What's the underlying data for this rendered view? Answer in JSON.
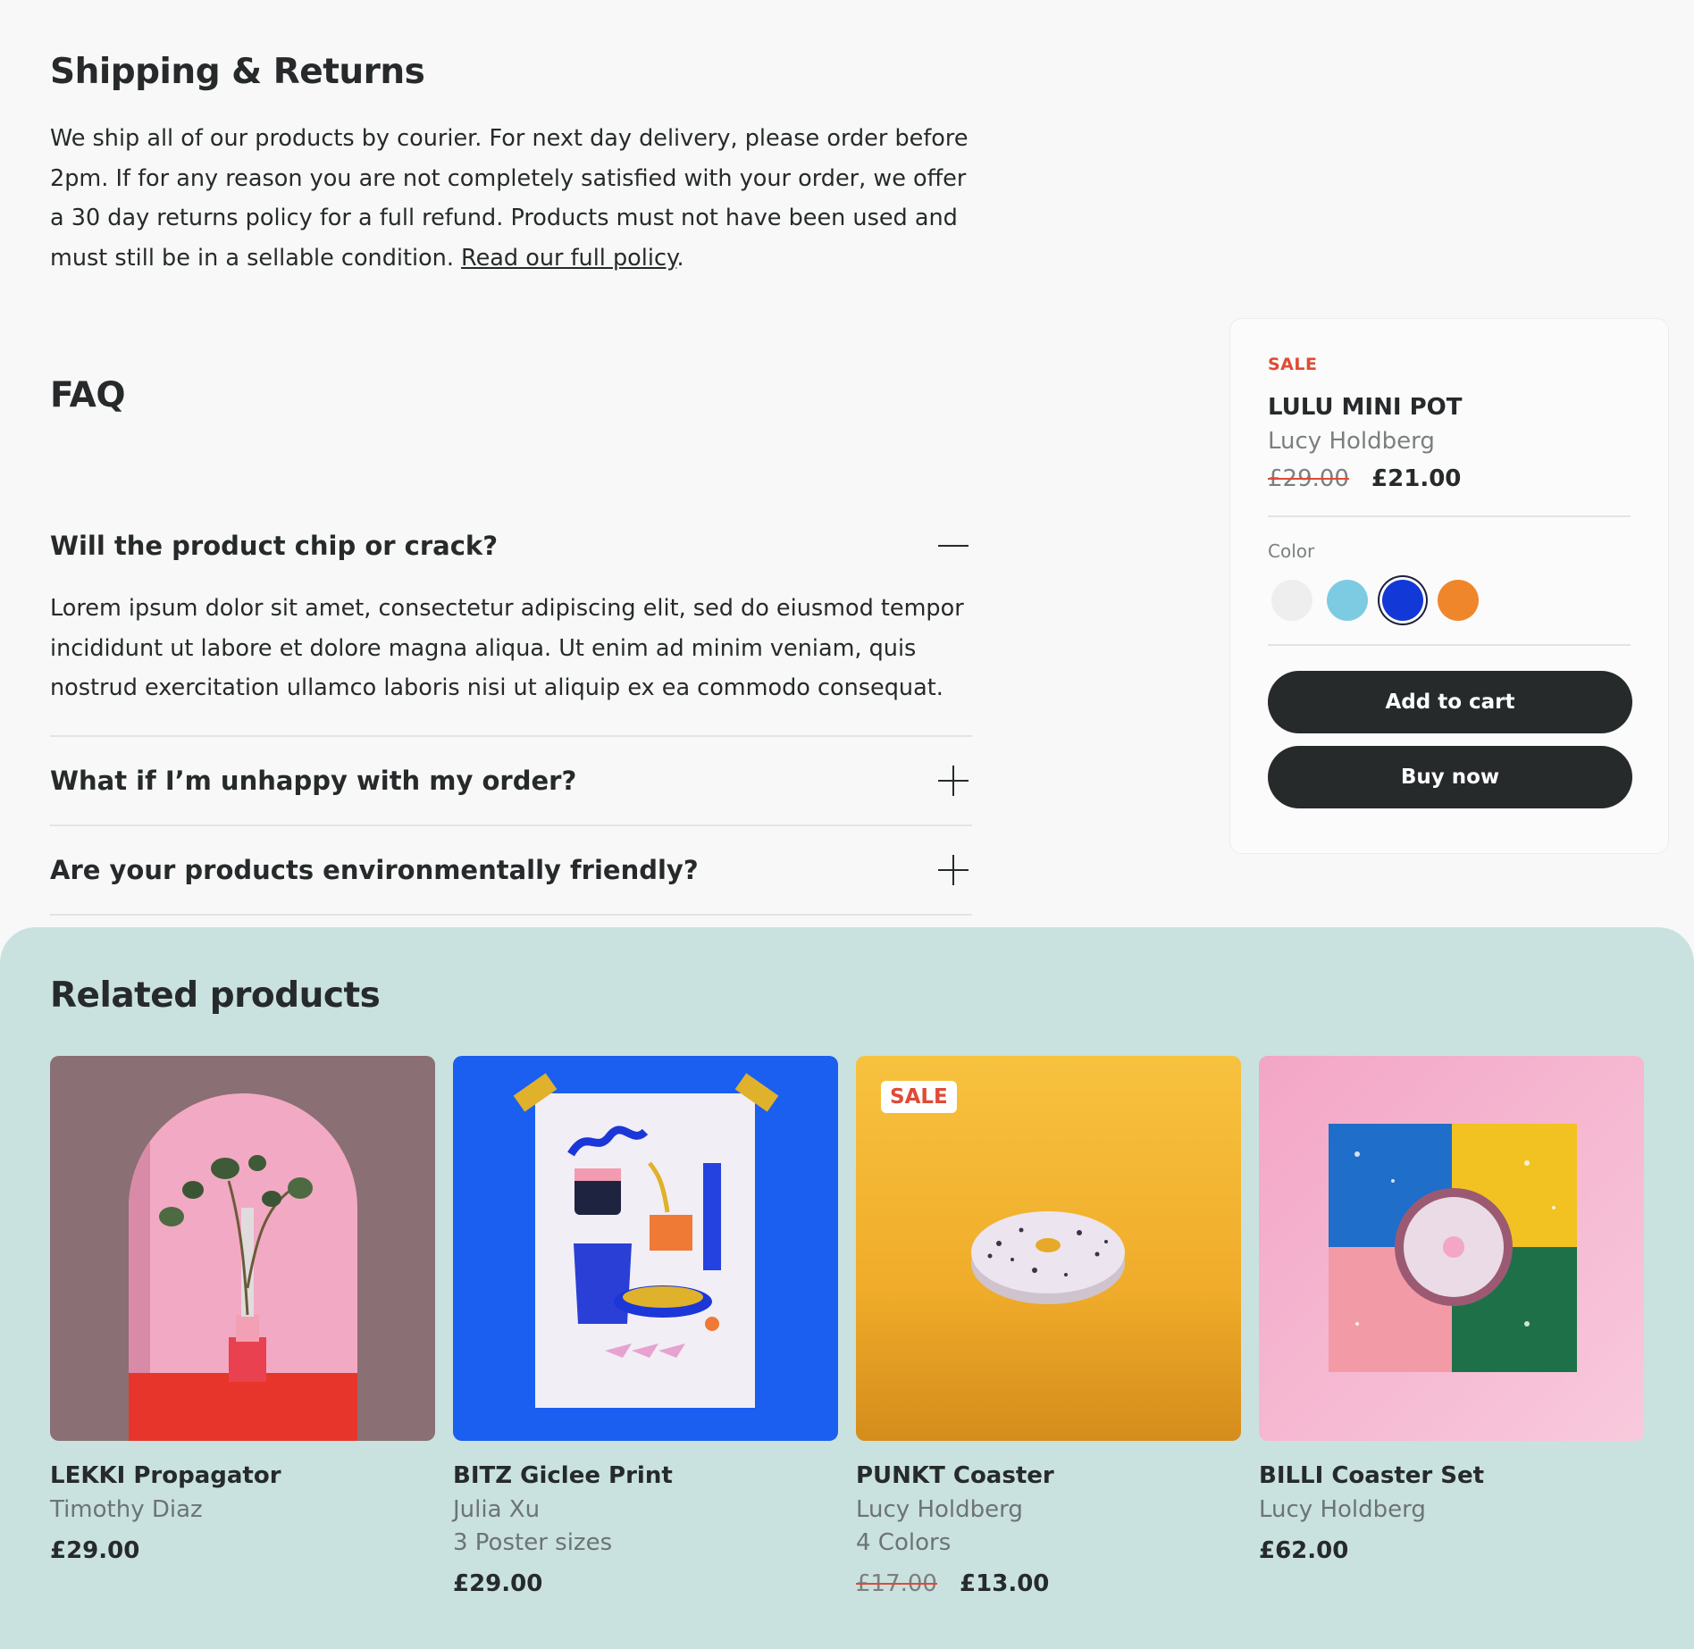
{
  "shipping": {
    "title": "Shipping & Returns",
    "body": "We ship all of our products by courier. For next day delivery, please order before 2pm. If for any reason you are not completely satisfied with your order, we offer a 30 day returns policy for a full refund. Products must not have been used and must still be in a sellable condition. ",
    "link": "Read our full policy",
    "after_link": "."
  },
  "faq": {
    "title": "FAQ",
    "items": [
      {
        "question": "Will the product chip or crack?",
        "expanded": true,
        "answer": "Lorem ipsum dolor sit amet, consectetur adipiscing elit, sed do eiusmod tempor incididunt ut labore et dolore magna aliqua. Ut enim ad minim veniam, quis nostrud exercitation ullamco laboris nisi ut aliquip ex ea commodo consequat."
      },
      {
        "question": "What if I’m unhappy with my order?",
        "expanded": false
      },
      {
        "question": "Are your products environmentally friendly?",
        "expanded": false
      }
    ]
  },
  "product_card": {
    "sale_label": "SALE",
    "title": "LULU MINI POT",
    "artist": "Lucy Holdberg",
    "old_price": "£29.00",
    "price": "£21.00",
    "color_label": "Color",
    "colors": [
      "#eeeeee",
      "#7ccbe3",
      "#1238d8",
      "#f0862b"
    ],
    "selected_color_index": 2,
    "add_to_cart": "Add to cart",
    "buy_now": "Buy now"
  },
  "related": {
    "title": "Related products",
    "products": [
      {
        "name": "LEKKI Propagator",
        "artist": "Timothy Diaz",
        "price": "£29.00",
        "image_icon": "plant-propagator-image"
      },
      {
        "name": "BITZ Giclee Print",
        "artist": "Julia Xu",
        "variants": "3 Poster sizes",
        "price": "£29.00",
        "image_icon": "poster-print-image"
      },
      {
        "name": "PUNKT Coaster",
        "artist": "Lucy Holdberg",
        "variants": "4 Colors",
        "old_price": "£17.00",
        "price": "£13.00",
        "badge": "SALE",
        "image_icon": "coaster-image"
      },
      {
        "name": "BILLI Coaster Set",
        "artist": "Lucy Holdberg",
        "price": "£62.00",
        "image_icon": "coaster-set-image"
      }
    ]
  }
}
